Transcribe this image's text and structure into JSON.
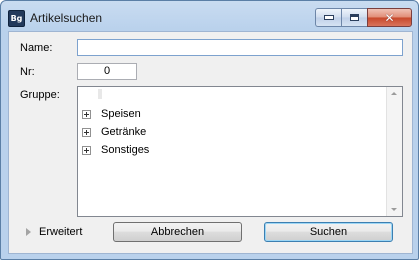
{
  "window": {
    "title": "Artikelsuchen",
    "icon_text": "Bg",
    "controls": {
      "minimize": "minimize-icon",
      "maximize": "maximize-icon",
      "close": "✕"
    }
  },
  "form": {
    "name_label": "Name:",
    "name_value": "",
    "nr_label": "Nr:",
    "nr_value": "0",
    "group_label": "Gruppe:"
  },
  "tree": {
    "items": [
      {
        "label": "Speisen"
      },
      {
        "label": "Getränke"
      },
      {
        "label": "Sonstiges"
      }
    ]
  },
  "footer": {
    "expand_label": "Erweitert",
    "cancel_label": "Abbrechen",
    "search_label": "Suchen"
  }
}
